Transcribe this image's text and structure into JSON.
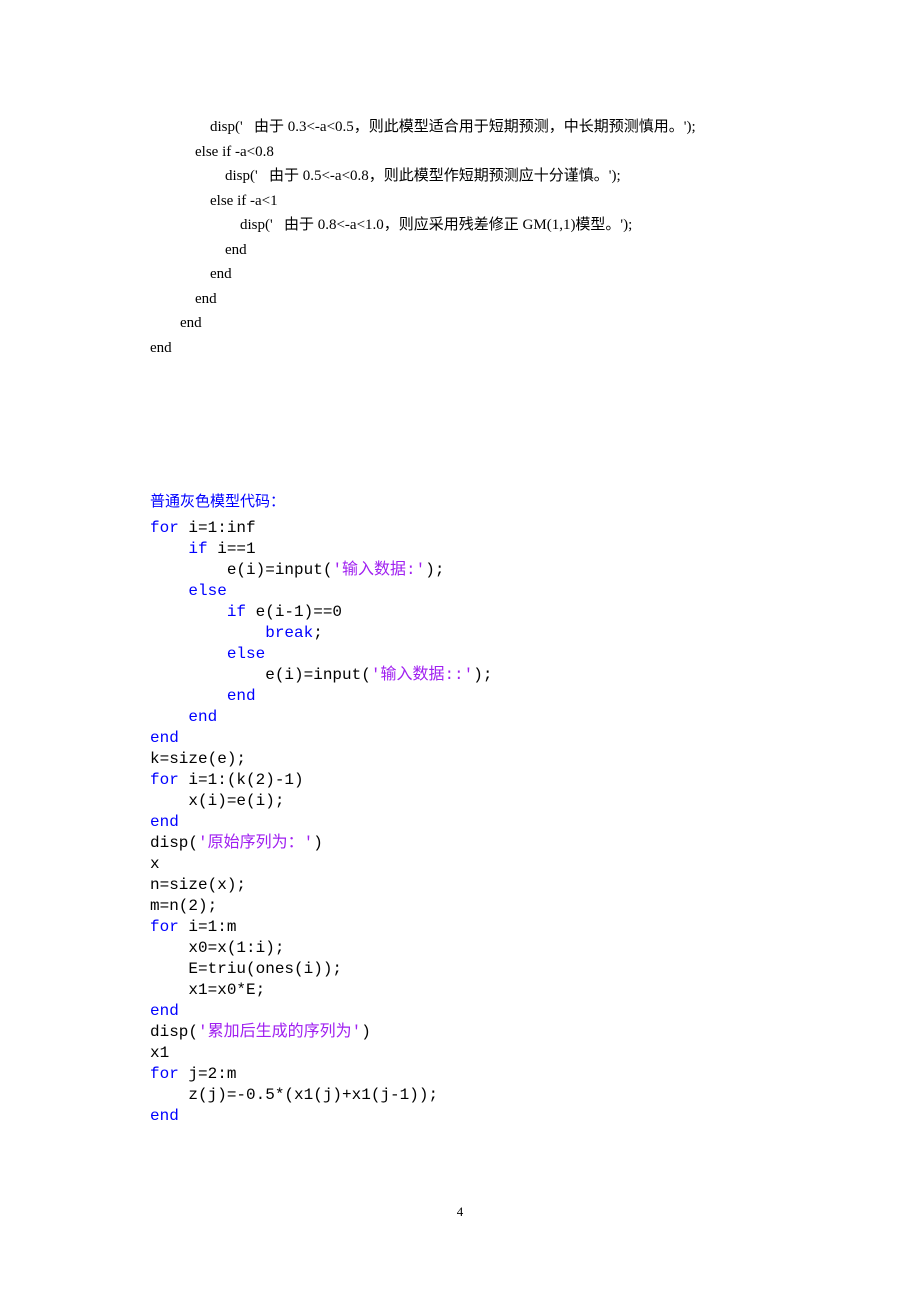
{
  "block1": {
    "l1": "                disp('   由于 0.3<-a<0.5，则此模型适合用于短期预测，中长期预测慎用。');",
    "l2": "            else if -a<0.8",
    "l3": "                    disp('   由于 0.5<-a<0.8，则此模型作短期预测应十分谨慎。');",
    "l4": "                else if -a<1",
    "l5": "                        disp('   由于 0.8<-a<1.0，则应采用残差修正 GM(1,1)模型。');",
    "l6": "                    end",
    "l7": "                end",
    "l8": "            end",
    "l9": "        end",
    "l10": "end"
  },
  "section_title": "普通灰色模型代码：",
  "code": {
    "l1": {
      "a": "for",
      "b": " i=1:inf"
    },
    "l2": {
      "a": "    if",
      "b": " i==1"
    },
    "l3": {
      "a": "        e(i)=input(",
      "s": "'输入数据:'",
      "c": ");"
    },
    "l4": {
      "a": "    else"
    },
    "l5": {
      "a": "        if",
      "b": " e(i-1)==0"
    },
    "l6": {
      "a": "            break",
      "b": ";"
    },
    "l7": {
      "a": "        else"
    },
    "l8": {
      "a": "            e(i)=input(",
      "s": "'输入数据::'",
      "c": ");"
    },
    "l9": {
      "a": "        end"
    },
    "l10": {
      "a": "    end"
    },
    "l11": {
      "a": "end"
    },
    "l12": {
      "a": "k=size(e);"
    },
    "l13": {
      "a": "for",
      "b": " i=1:(k(2)-1)"
    },
    "l14": {
      "a": "    x(i)=e(i);"
    },
    "l15": {
      "a": "end"
    },
    "l16": {
      "a": "disp(",
      "s": "'原始序列为：'",
      "c": ")"
    },
    "l17": {
      "a": "x"
    },
    "l18": {
      "a": "n=size(x);"
    },
    "l19": {
      "a": "m=n(2);"
    },
    "l20": {
      "a": "for",
      "b": " i=1:m"
    },
    "l21": {
      "a": "    x0=x(1:i);"
    },
    "l22": {
      "a": "    E=triu(ones(i));"
    },
    "l23": {
      "a": "    x1=x0*E;"
    },
    "l24": {
      "a": "end"
    },
    "l25": {
      "a": "disp(",
      "s": "'累加后生成的序列为'",
      "c": ")"
    },
    "l26": {
      "a": "x1"
    },
    "l27": {
      "a": "for",
      "b": " j=2:m"
    },
    "l28": {
      "a": "    z(j)=-0.5*(x1(j)+x1(j-1));"
    },
    "l29": {
      "a": "end"
    }
  },
  "page_number": "4"
}
